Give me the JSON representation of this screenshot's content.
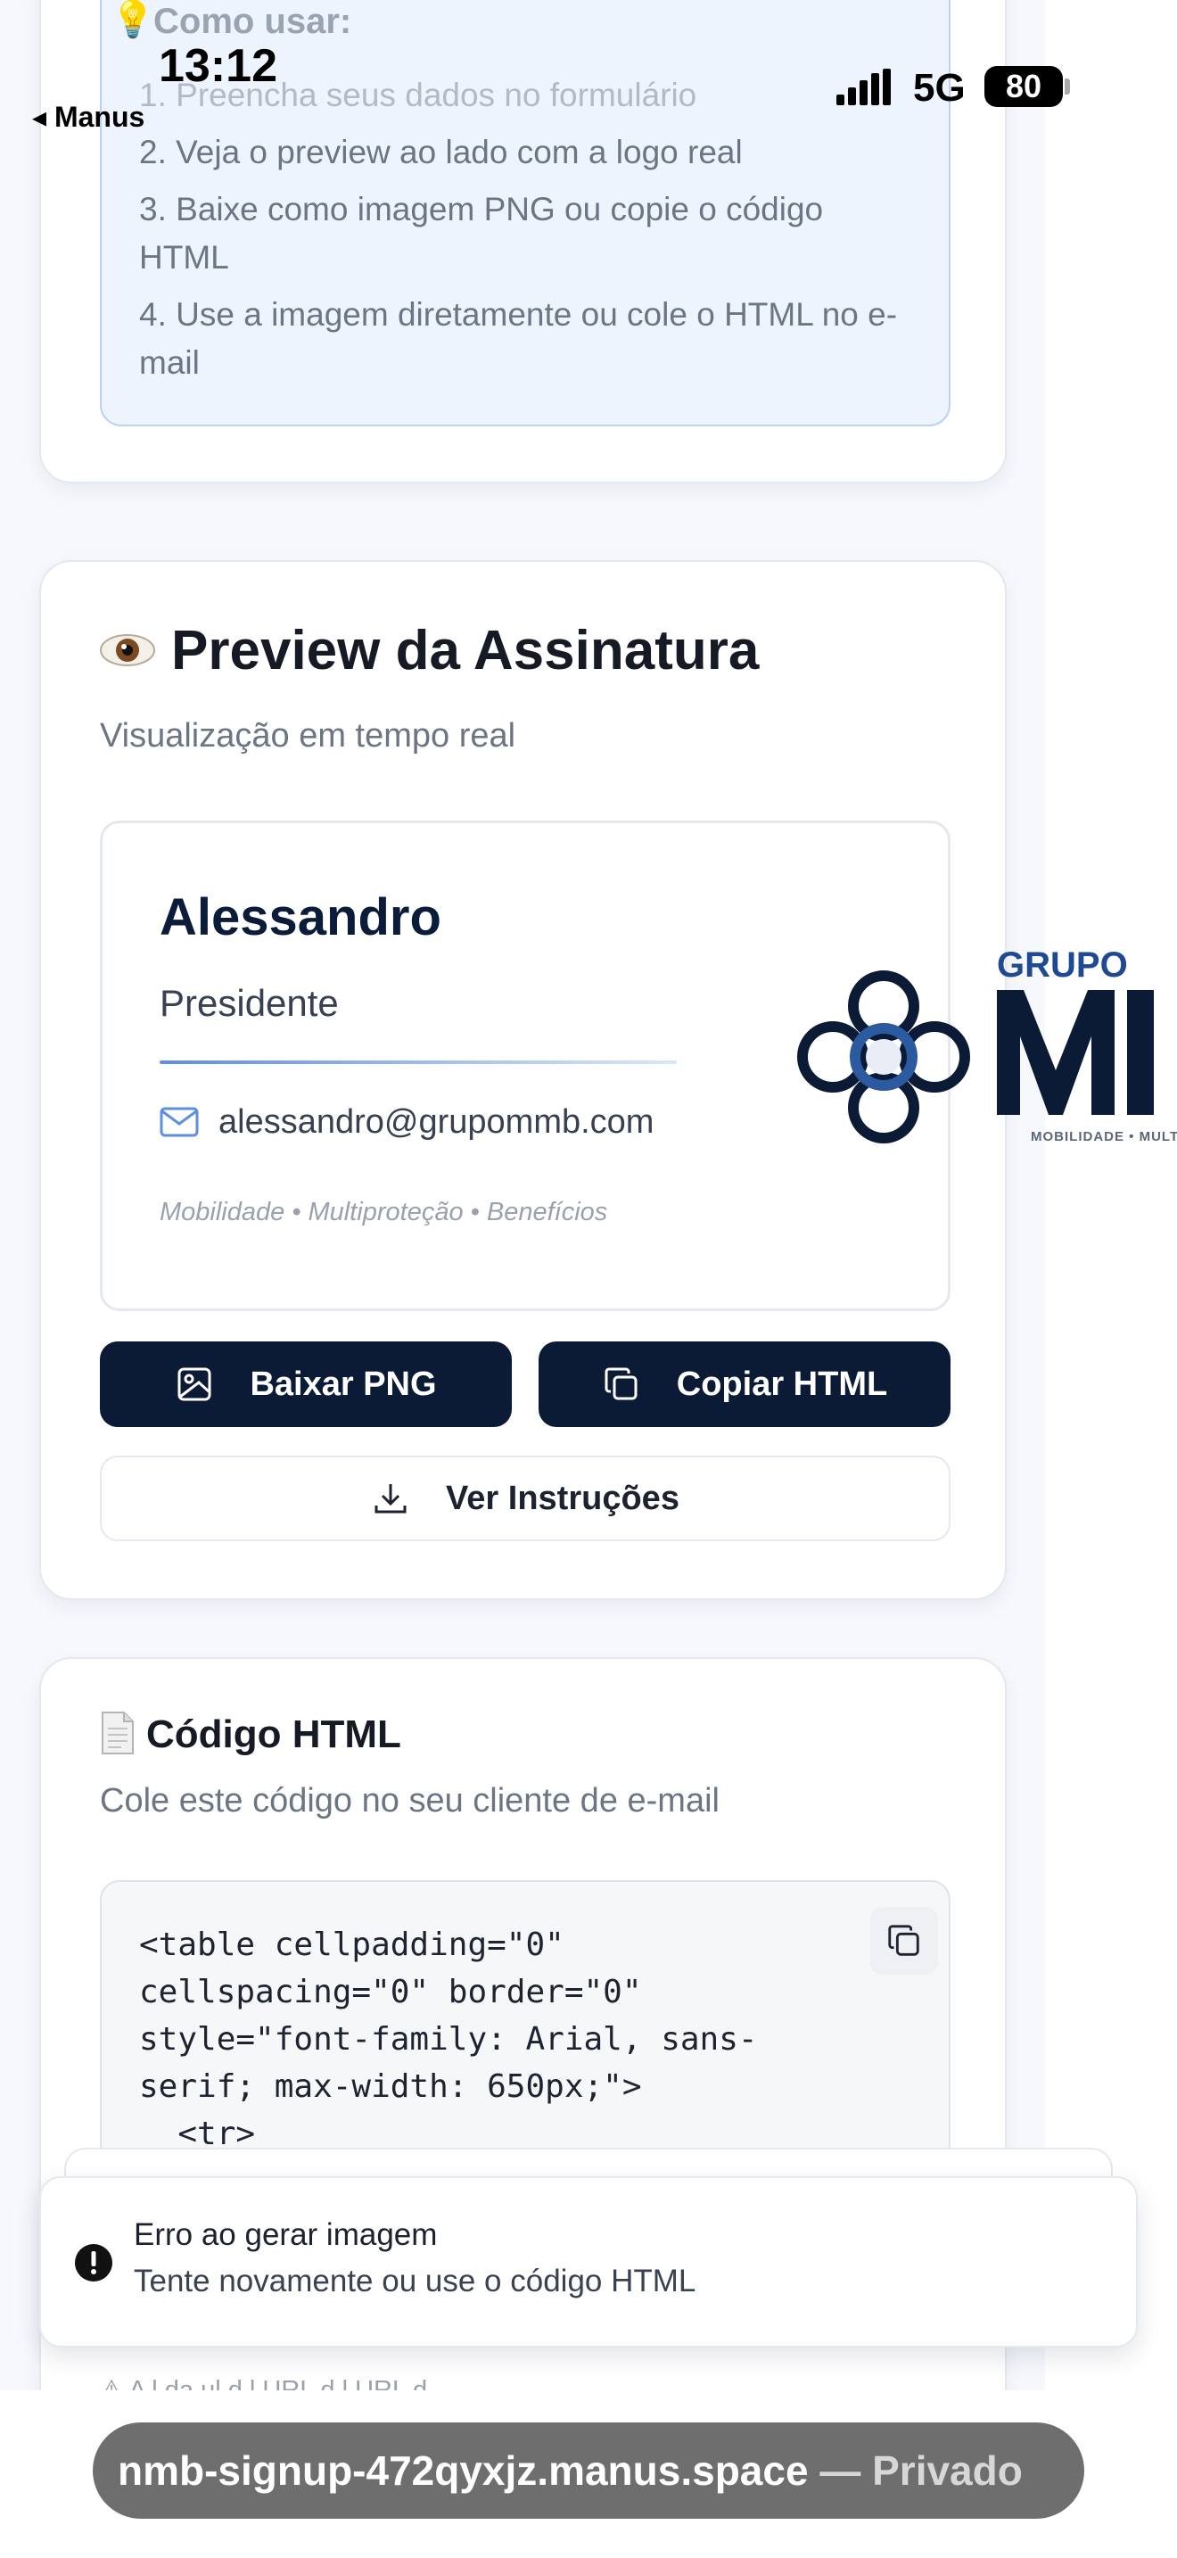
{
  "status_bar": {
    "time": "13:12",
    "back_app": "◂ Manus",
    "network": "5G",
    "battery": "80"
  },
  "howto": {
    "icon": "lightbulb-icon",
    "title": "Como usar:",
    "steps": [
      "1. Preencha seus dados no formulário",
      "2. Veja o preview ao lado com a logo real",
      "3. Baixe como imagem PNG ou copie o código HTML",
      "4. Use a imagem diretamente ou cole o HTML no e-mail"
    ]
  },
  "preview": {
    "icon": "eye-icon",
    "title": "Preview da Assinatura",
    "subtitle": "Visualização em tempo real",
    "signature": {
      "name": "Alessandro",
      "role": "Presidente",
      "email_icon": "mail-icon",
      "email": "alessandro@grupommb.com",
      "tagline": "Mobilidade • Multiproteção • Benefícios",
      "logo_top": "GRUPO",
      "logo_sub": "MOBILIDADE • MULT"
    },
    "buttons": {
      "download_png": "Baixar PNG",
      "copy_html": "Copiar HTML",
      "instructions": "Ver Instruções"
    }
  },
  "code": {
    "icon": "document-icon",
    "title": "Código HTML",
    "subtitle": "Cole este código no seu cliente de e-mail",
    "snippet": "<table cellpadding=\"0\" cellspacing=\"0\" border=\"0\" style=\"font-family: Arial, sans-serif; max-width: 650px;\">\n  <tr>",
    "footer_note_partial": "⚠ A   l  da  ul  d l  URL  d   l   URL d"
  },
  "toast": {
    "icon": "error-icon",
    "title": "Erro ao gerar imagem",
    "message": "Tente novamente ou use o código HTML"
  },
  "url_bar": {
    "domain": "nmb-signup-472qyxjz.manus.space",
    "privacy": "— Privado"
  },
  "colors": {
    "brand_navy": "#0b1a35",
    "brand_blue": "#1f4a93",
    "accent_blue": "#5d8fe0",
    "info_bg": "#eef4fe"
  }
}
